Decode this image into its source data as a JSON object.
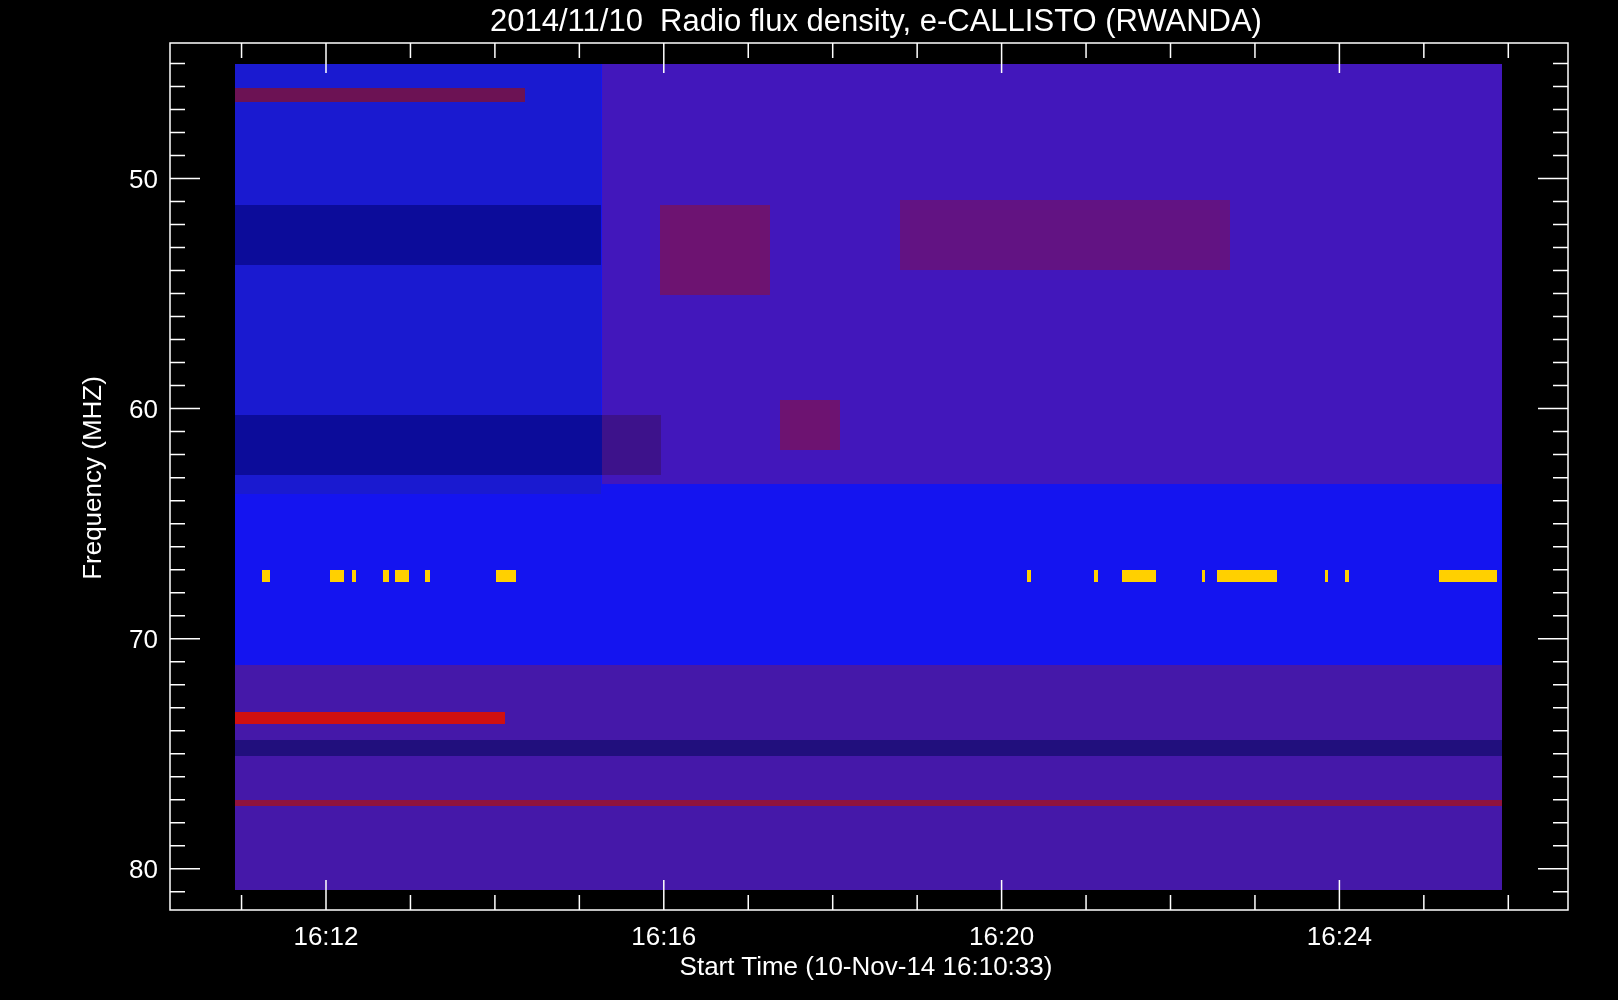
{
  "plot": {
    "title": "2014/11/10  Radio flux density, e-CALLISTO (RWANDA)",
    "xlabel": "Start Time (10-Nov-14 16:10:33)",
    "ylabel": "Frequency (MHZ)",
    "xticks": [
      "16:12",
      "16:16",
      "16:20",
      "16:24"
    ],
    "yticks": [
      "50",
      "60",
      "70",
      "80"
    ]
  }
}
